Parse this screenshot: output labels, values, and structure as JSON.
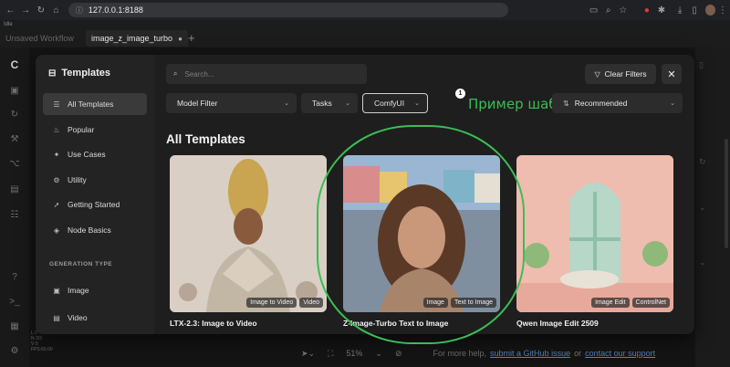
{
  "browser": {
    "url": "127.0.0.1:8188"
  },
  "app": {
    "status": "Idle",
    "tabs": [
      {
        "label": "Unsaved Workflow"
      },
      {
        "label": "image_z_image_turbo"
      }
    ],
    "fps_lines": [
      "L 0",
      "N 3/3",
      "V 0",
      "FPS:60.00"
    ],
    "bottom": {
      "zoom": "51%",
      "help_prefix": "For more help,",
      "help_link1": "submit a GitHub issue",
      "help_or": "or",
      "help_link2": "contact our support"
    }
  },
  "modal": {
    "title": "Templates",
    "sidebar": {
      "items": [
        {
          "label": "All Templates",
          "icon": "list-icon",
          "glyph": "☰",
          "active": true
        },
        {
          "label": "Popular",
          "icon": "flame-icon",
          "glyph": "♨"
        },
        {
          "label": "Use Cases",
          "icon": "star-icon",
          "glyph": "✦"
        },
        {
          "label": "Utility",
          "icon": "gear-icon",
          "glyph": "⚙"
        },
        {
          "label": "Getting Started",
          "icon": "rocket-icon",
          "glyph": "➚"
        },
        {
          "label": "Node Basics",
          "icon": "graduation-icon",
          "glyph": "◈"
        }
      ],
      "section_label": "GENERATION TYPE",
      "gen_items": [
        {
          "label": "Image",
          "icon": "image-icon",
          "glyph": "▣"
        },
        {
          "label": "Video",
          "icon": "video-icon",
          "glyph": "▤"
        }
      ]
    },
    "search": {
      "placeholder": "Search..."
    },
    "clear_filters_label": "Clear Filters",
    "filters": {
      "model": "Model Filter",
      "tasks": "Tasks",
      "comfy": "ComfyUI",
      "comfy_badge": "1",
      "sort": "Recommended"
    },
    "annotation_text": "Пример шаблона",
    "section_title": "All Templates",
    "cards": [
      {
        "title": "LTX-2.3: Image to Video",
        "tags": [
          "Image to Video",
          "Video"
        ]
      },
      {
        "title": "Z-Image-Turbo Text to Image",
        "tags": [
          "Image",
          "Text to Image"
        ]
      },
      {
        "title": "Qwen Image Edit 2509",
        "tags": [
          "Image Edit",
          "ControlNet"
        ]
      }
    ]
  },
  "colors": {
    "accent_annotation": "#3cbd55",
    "modal_bg": "#1e1e1e",
    "sidebar_bg": "#232323"
  }
}
